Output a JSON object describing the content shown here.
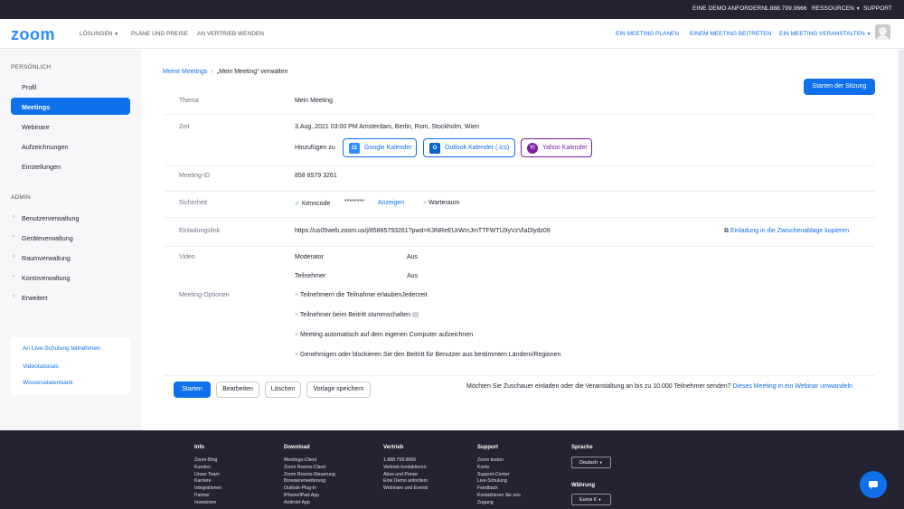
{
  "topbar": {
    "demo": "EINE DEMO ANFORDERN",
    "phone": "1.888.799.9666",
    "resources": "RESSOURCEN",
    "support": "SUPPORT"
  },
  "header": {
    "logo": "zoom",
    "nav": [
      "LÖSUNGEN",
      "PLÄNE UND PREISE",
      "AN VERTRIEB WENDEN"
    ],
    "right": [
      "EIN MEETING PLANEN",
      "EINEM MEETING BEITRETEN",
      "EIN MEETING VERANSTALTEN"
    ]
  },
  "sidebar": {
    "personal_title": "PERSÖNLICH",
    "personal": [
      "Profil",
      "Meetings",
      "Webinare",
      "Aufzeichnungen",
      "Einstellungen"
    ],
    "admin_title": "ADMIN",
    "admin": [
      "Benutzerverwaltung",
      "Geräteverwaltung",
      "Raumverwaltung",
      "Kontoverwaltung",
      "Erweitert"
    ],
    "help": [
      "An Live-Schulung teilnehmen",
      "Videotutorials",
      "Wissensdatenbank"
    ]
  },
  "main": {
    "breadcrumb": {
      "parent": "Meine Meetings",
      "current": "„Mein Meeting\" verwalten"
    },
    "start_session": "Starten der Sitzung",
    "topic": {
      "label": "Thema",
      "value": "Mein Meeting"
    },
    "time": {
      "label": "Zeit",
      "value": "3.Aug..2021 03:00 PM Amsterdam, Berlin, Rom, Stockholm, Wien",
      "add_to": "Hinzufügen zu",
      "google": "Google Kalender",
      "outlook": "Outlook Kalender (.ics)",
      "yahoo": "Yahoo Kalender"
    },
    "meeting_id": {
      "label": "Meeting-ID",
      "value": "858 8579 3261"
    },
    "security": {
      "label": "Sicherheit",
      "passcode": "Kenncode",
      "passcode_mask": "********",
      "show": "Anzeigen",
      "waiting_room": "Warteraum"
    },
    "invite": {
      "label": "Einladungslink",
      "url": "https://us05web.zoom.us/j/85885793261?pwd=K3NReEUrWmJmTTFWTU9yVzVlaDlydz09",
      "copy": "Einladung in die Zwischenablage kopieren"
    },
    "video": {
      "label": "Video",
      "host": "Moderator",
      "host_val": "Aus",
      "participants": "Teilnehmer",
      "participants_val": "Aus"
    },
    "options": {
      "label": "Meeting-Optionen",
      "items": [
        "Teilnehmern die Teilnahme erlaubenJederzeit",
        "Teilnehmer beim Beitritt stummschalten",
        "Meeting automatisch auf dem eigenen Computer aufzeichnen",
        "Genehmigen oder blockieren Sie den Beitritt für Benutzer aus bestimmten Ländern/Regionen"
      ]
    },
    "actions": {
      "start": "Starten",
      "edit": "Bearbeiten",
      "delete": "Löschen",
      "save_template": "Vorlage speichern",
      "webinar_question": "Möchten Sie Zuschauer einladen oder die Veranstaltung an bis zu 10.000 Teilnehmer senden?",
      "webinar_link": "Dieses Meeting in ein Webinar umwandeln"
    }
  },
  "footer": {
    "info": {
      "title": "Info",
      "items": [
        "Zoom-Blog",
        "Kunden",
        "Unser Team",
        "Karriere",
        "Integrationen",
        "Partner",
        "Investoren"
      ]
    },
    "download": {
      "title": "Download",
      "items": [
        "Meetings-Client",
        "Zoom Rooms-Client",
        "Zoom Rooms-Steuerung",
        "Browsererweiterung",
        "Outlook-Plug-In",
        "iPhone/iPad-App",
        "Android-App"
      ]
    },
    "sales": {
      "title": "Vertrieb",
      "items": [
        "1.888.799.9666",
        "Vertrieb kontaktieren",
        "Abos und Preise",
        "Eine Demo anfordern",
        "Webinare und Events"
      ]
    },
    "support": {
      "title": "Support",
      "items": [
        "Zoom testen",
        "Konto",
        "Support-Center",
        "Live-Schulung",
        "Feedback",
        "Kontaktieren Sie uns",
        "Zugang"
      ]
    },
    "language": {
      "title": "Sprache",
      "value": "Deutsch"
    },
    "currency": {
      "title": "Währung",
      "value": "Euros €"
    }
  }
}
